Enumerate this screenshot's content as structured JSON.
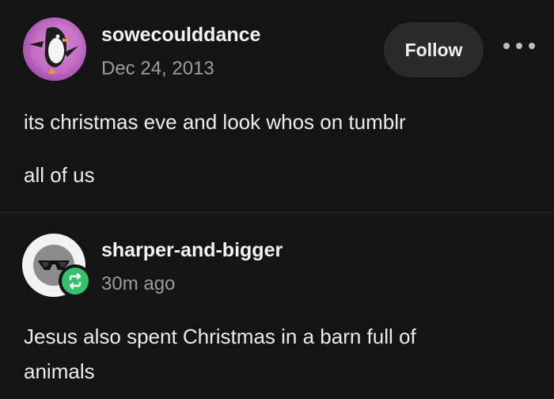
{
  "original_post": {
    "username": "sowecoulddance",
    "date": "Dec 24, 2013",
    "follow_label": "Follow",
    "avatar_icon": "penguin-avatar",
    "more_icon": "more-dots-icon",
    "body_lines": [
      "its christmas eve and look whos on tumblr",
      "all of us"
    ]
  },
  "reblog_post": {
    "username": "sharper-and-bigger",
    "time": "30m ago",
    "avatar_icon": "sunglasses-avatar",
    "badge_icon": "reblog-icon",
    "badge_color": "#35c16c",
    "body_lines": [
      "Jesus also spent Christmas in a barn full of",
      "animals"
    ]
  },
  "colors": {
    "background": "#141414",
    "button_bg": "#2a2a2a",
    "muted_text": "#9b9b9b"
  }
}
